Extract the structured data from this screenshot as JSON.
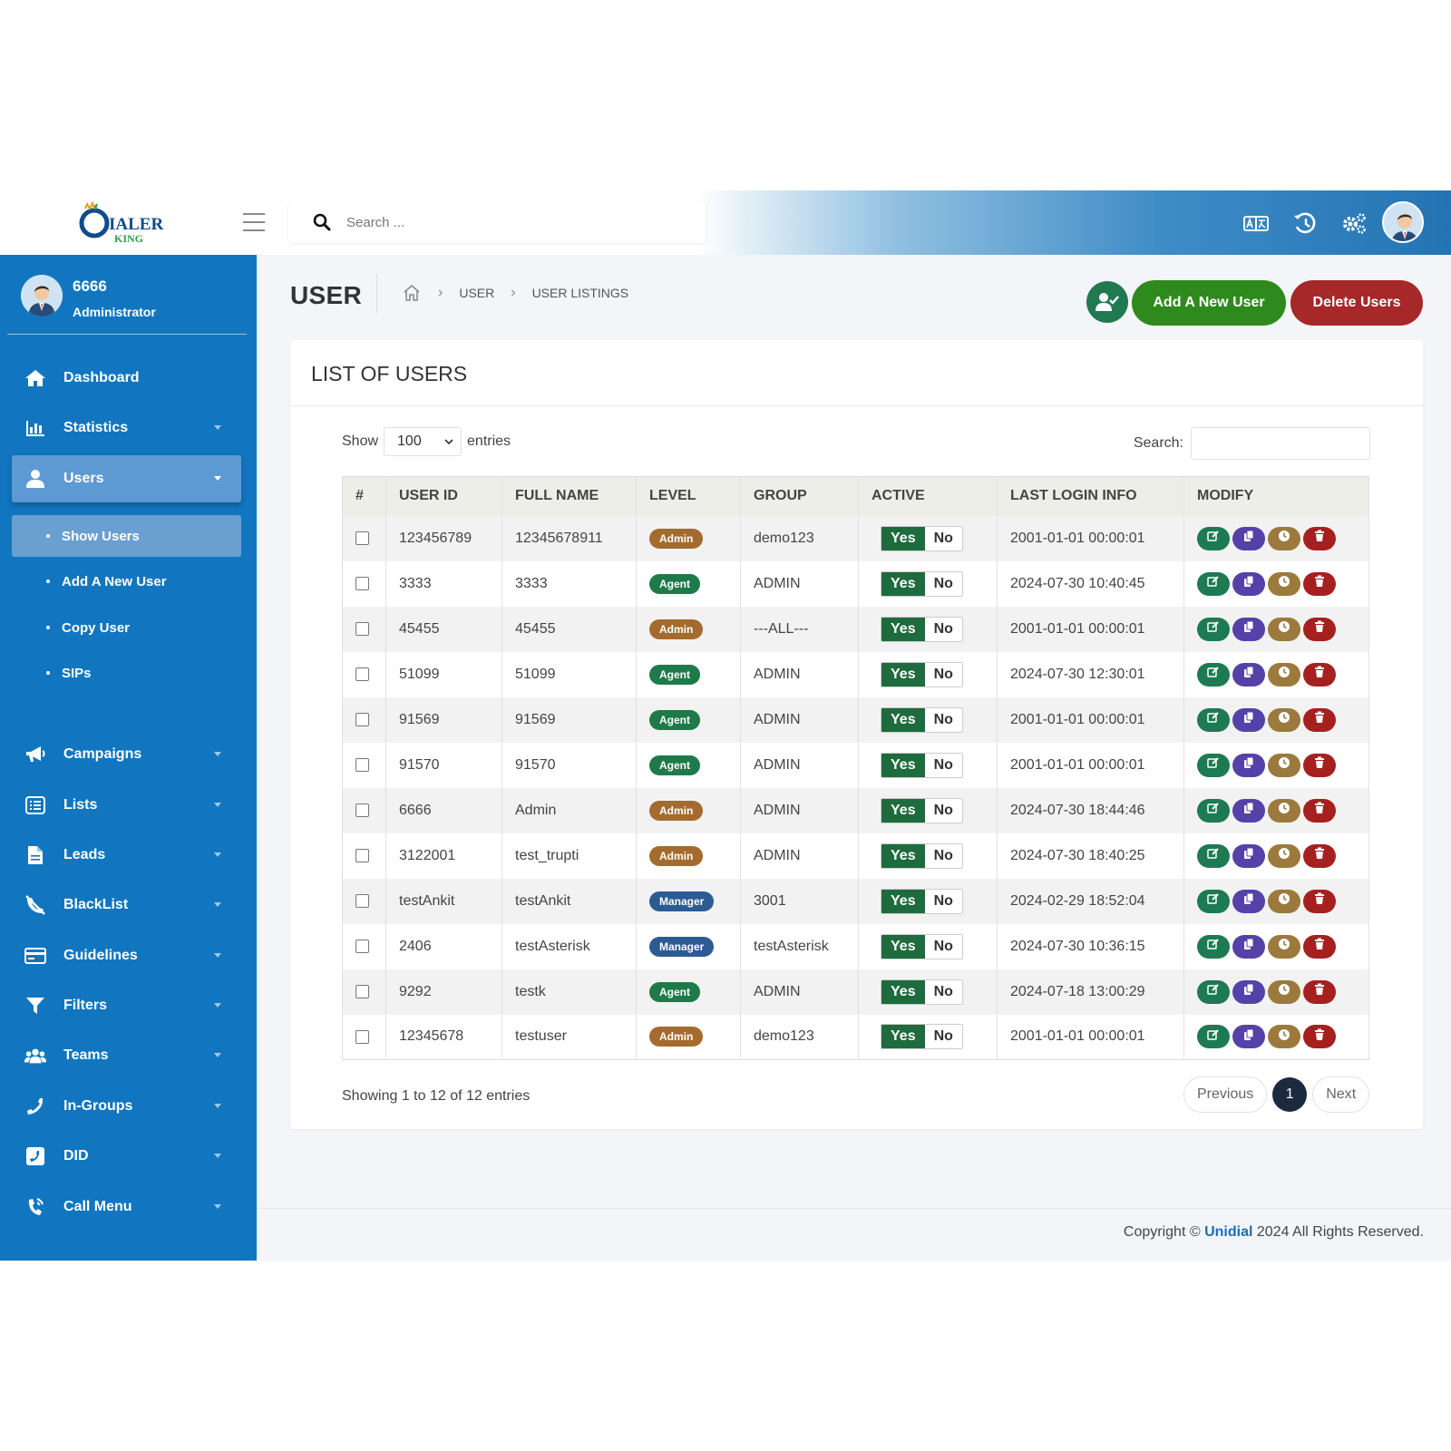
{
  "header": {
    "search_placeholder": "Search ...",
    "icons": [
      "translate-icon",
      "history-icon",
      "settings-icon",
      "avatar"
    ]
  },
  "sidebar": {
    "user": {
      "name": "6666",
      "role": "Administrator"
    },
    "items": [
      {
        "label": "Dashboard",
        "icon": "home-icon"
      },
      {
        "label": "Statistics",
        "icon": "chart-icon"
      },
      {
        "label": "Users",
        "icon": "user-icon",
        "active": true
      },
      {
        "label": "Campaigns",
        "icon": "megaphone-icon"
      },
      {
        "label": "Lists",
        "icon": "list-icon"
      },
      {
        "label": "Leads",
        "icon": "file-icon"
      },
      {
        "label": "BlackList",
        "icon": "blocked-phone-icon"
      },
      {
        "label": "Guidelines",
        "icon": "card-icon"
      },
      {
        "label": "Filters",
        "icon": "filter-icon"
      },
      {
        "label": "Teams",
        "icon": "team-icon"
      },
      {
        "label": "In-Groups",
        "icon": "phone-icon"
      },
      {
        "label": "DID",
        "icon": "did-icon"
      },
      {
        "label": "Call Menu",
        "icon": "call-menu-icon"
      }
    ],
    "users_submenu": [
      {
        "label": "Show Users",
        "active": true
      },
      {
        "label": "Add A New User"
      },
      {
        "label": "Copy User"
      },
      {
        "label": "SIPs"
      }
    ]
  },
  "page": {
    "title": "USER",
    "breadcrumb": [
      "USER",
      "USER LISTINGS"
    ],
    "add_button": "Add A New User",
    "delete_button": "Delete Users"
  },
  "card": {
    "title": "LIST OF USERS",
    "show_label": "Show",
    "entries_value": "100",
    "entries_label": "entries",
    "search_label": "Search:",
    "info": "Showing 1 to 12 of 12 entries",
    "pagination": {
      "previous": "Previous",
      "current": "1",
      "next": "Next"
    }
  },
  "table": {
    "columns": [
      "#",
      "USER ID",
      "FULL NAME",
      "LEVEL",
      "GROUP",
      "ACTIVE",
      "LAST LOGIN INFO",
      "MODIFY"
    ],
    "active_yes": "Yes",
    "active_no": "No",
    "rows": [
      {
        "user_id": "123456789",
        "full_name": "12345678911",
        "level": "Admin",
        "group": "demo123",
        "last_login": "2001-01-01 00:00:01"
      },
      {
        "user_id": "3333",
        "full_name": "3333",
        "level": "Agent",
        "group": "ADMIN",
        "last_login": "2024-07-30 10:40:45"
      },
      {
        "user_id": "45455",
        "full_name": "45455",
        "level": "Admin",
        "group": "---ALL---",
        "last_login": "2001-01-01 00:00:01"
      },
      {
        "user_id": "51099",
        "full_name": "51099",
        "level": "Agent",
        "group": "ADMIN",
        "last_login": "2024-07-30 12:30:01"
      },
      {
        "user_id": "91569",
        "full_name": "91569",
        "level": "Agent",
        "group": "ADMIN",
        "last_login": "2001-01-01 00:00:01"
      },
      {
        "user_id": "91570",
        "full_name": "91570",
        "level": "Agent",
        "group": "ADMIN",
        "last_login": "2001-01-01 00:00:01"
      },
      {
        "user_id": "6666",
        "full_name": "Admin",
        "level": "Admin",
        "group": "ADMIN",
        "last_login": "2024-07-30 18:44:46"
      },
      {
        "user_id": "3122001",
        "full_name": "test_trupti",
        "level": "Admin",
        "group": "ADMIN",
        "last_login": "2024-07-30 18:40:25"
      },
      {
        "user_id": "testAnkit",
        "full_name": "testAnkit",
        "level": "Manager",
        "group": "3001",
        "last_login": "2024-02-29 18:52:04"
      },
      {
        "user_id": "2406",
        "full_name": "testAsterisk",
        "level": "Manager",
        "group": "testAsterisk",
        "last_login": "2024-07-30 10:36:15"
      },
      {
        "user_id": "9292",
        "full_name": "testk",
        "level": "Agent",
        "group": "ADMIN",
        "last_login": "2024-07-18 13:00:29"
      },
      {
        "user_id": "12345678",
        "full_name": "testuser",
        "level": "Admin",
        "group": "demo123",
        "last_login": "2001-01-01 00:00:01"
      }
    ]
  },
  "footer": {
    "prefix": "Copyright ©",
    "brand": "Unidial",
    "suffix": "2024 All Rights Reserved."
  },
  "colors": {
    "sidebar": "#1176bf",
    "add_button": "#2f8a1d",
    "delete_button": "#a62828",
    "admin_badge": "#a36b2d",
    "agent_badge": "#1f7a4a",
    "manager_badge": "#2c5b94"
  }
}
